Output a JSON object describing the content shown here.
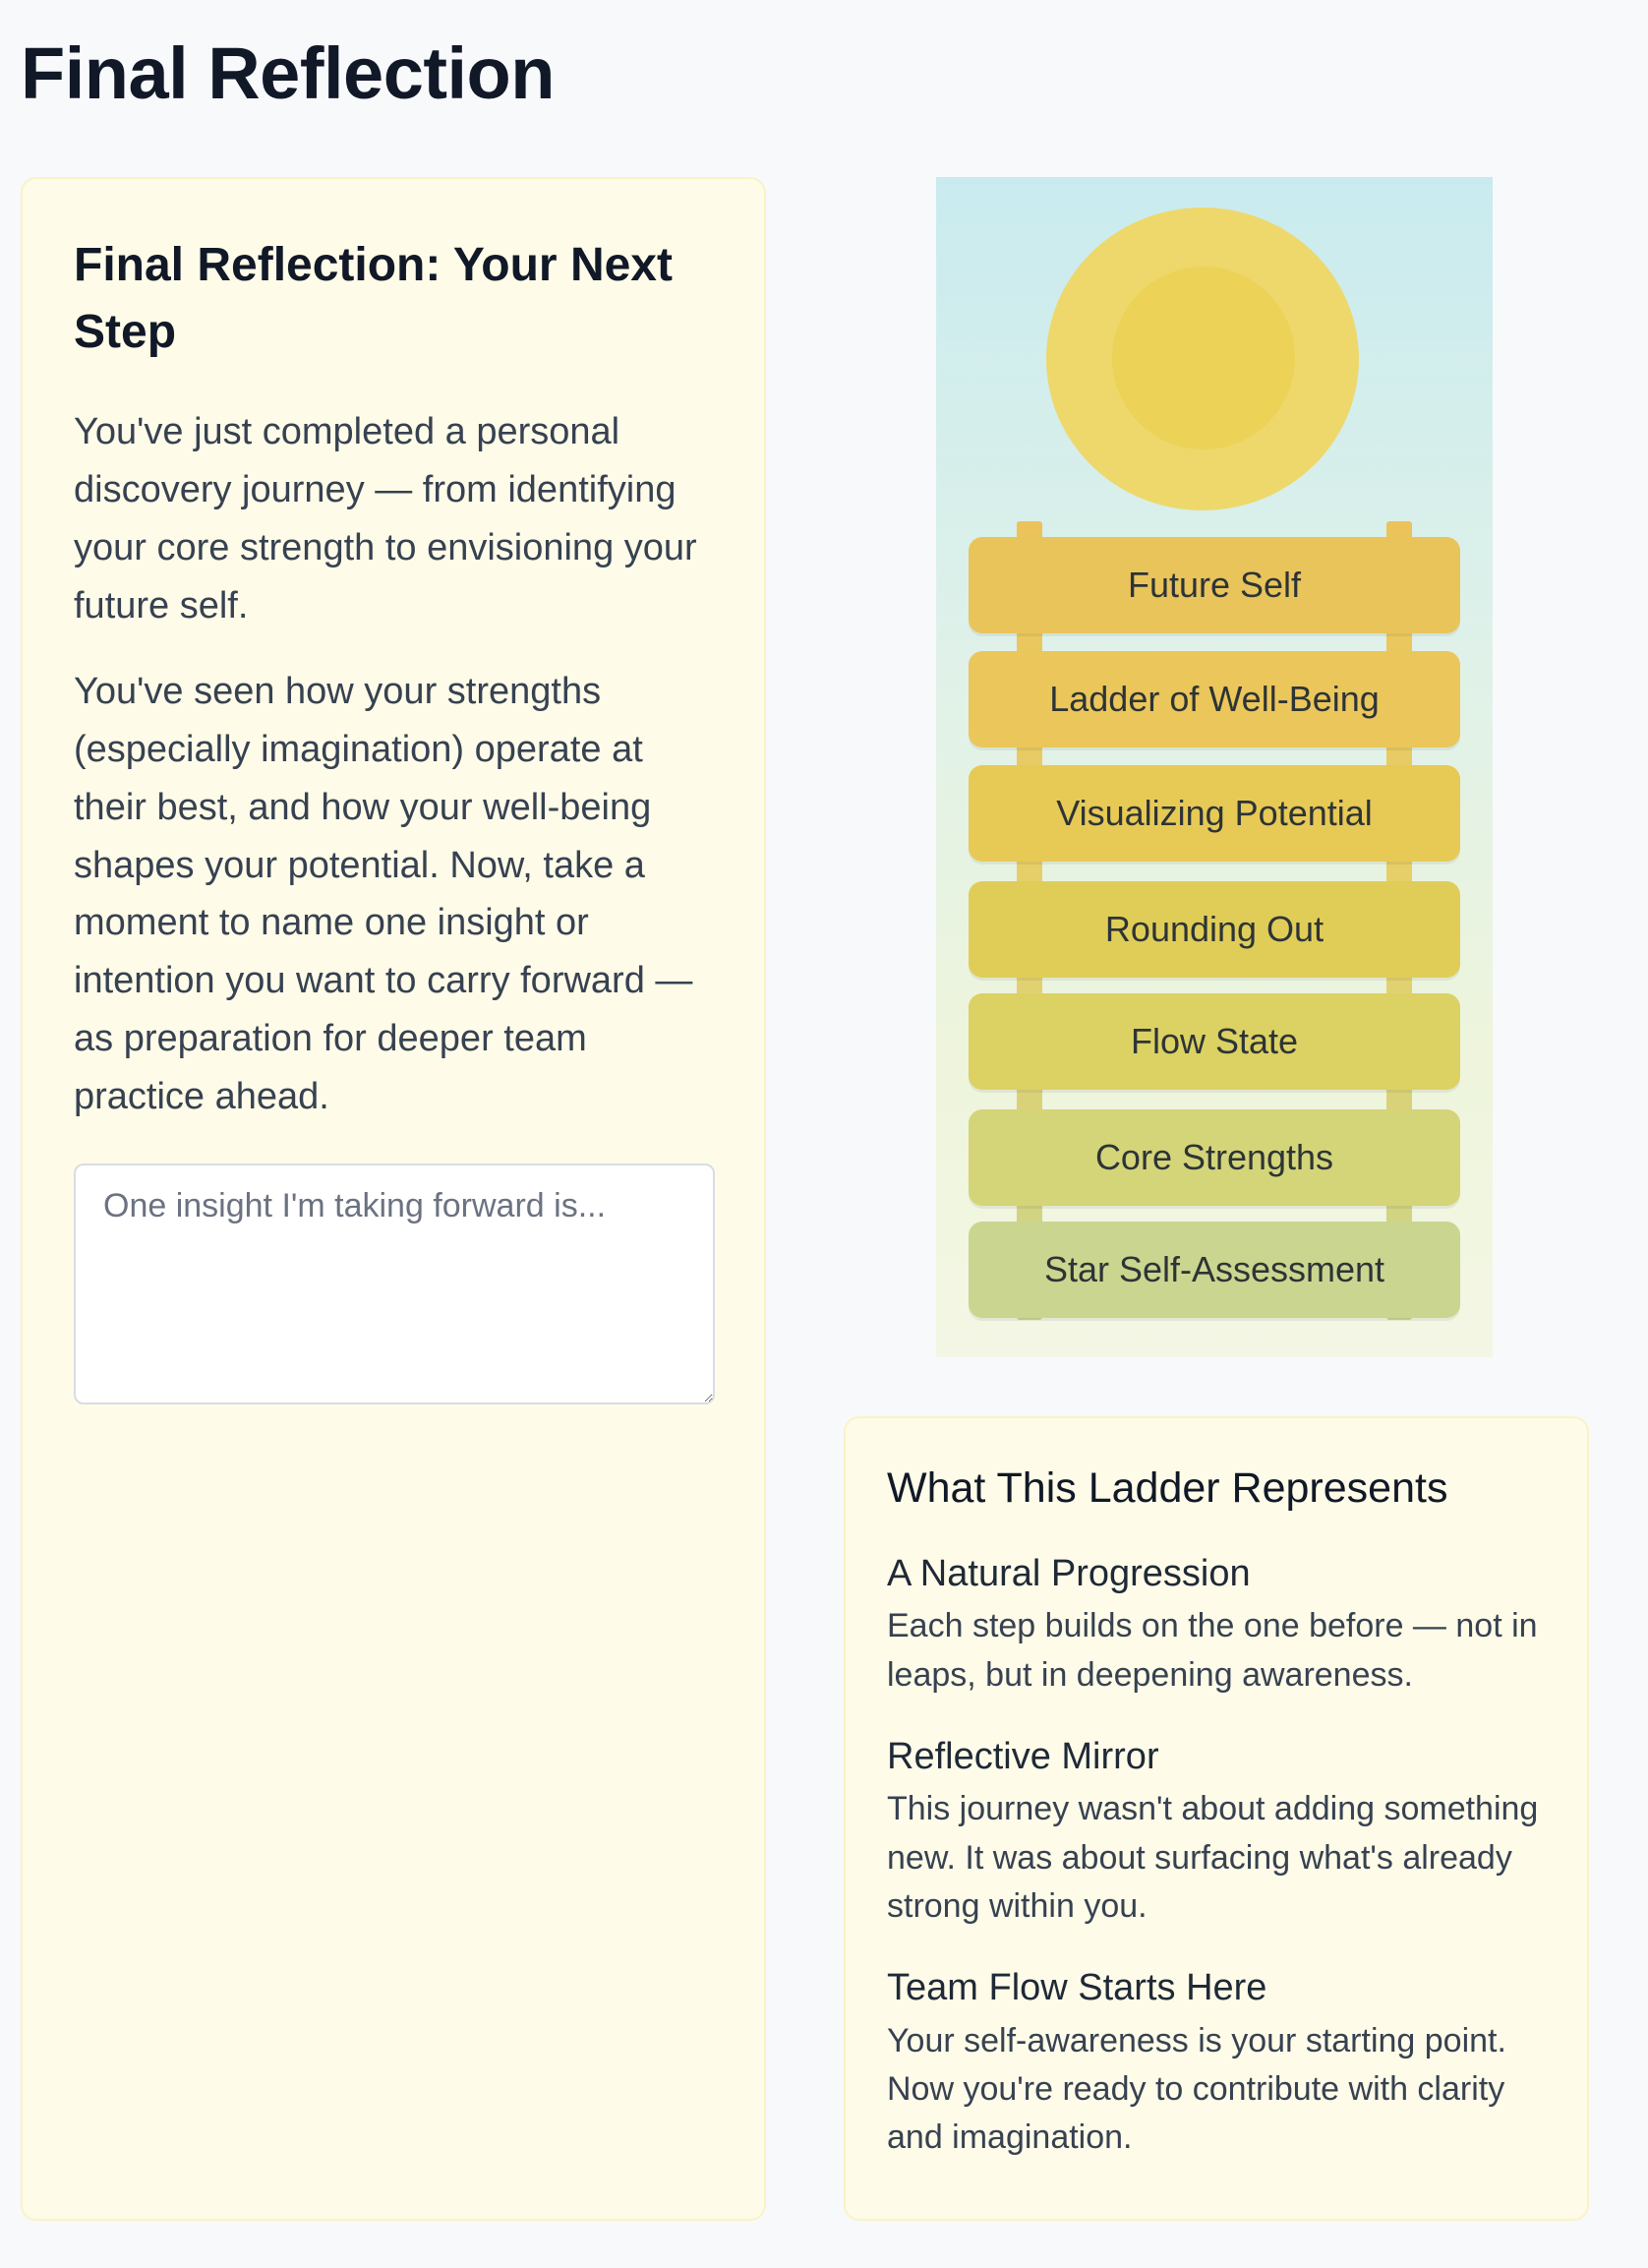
{
  "page": {
    "title": "Final Reflection"
  },
  "reflection_card": {
    "heading": "Final Reflection: Your Next Step",
    "paragraph_1": "You've just completed a personal discovery journey — from identifying your core strength to envisioning your future self.",
    "paragraph_2": "You've seen how your strengths (especially imagination) operate at their best, and how your well-being shapes your potential. Now, take a moment to name one insight or intention you want to carry forward — as preparation for deeper team practice ahead.",
    "input": {
      "value": "",
      "placeholder": "One insight I'm taking forward is..."
    }
  },
  "ladder": {
    "rungs": [
      {
        "label": "Future Self",
        "color": "#e9c45b"
      },
      {
        "label": "Ladder of Well-Being",
        "color": "#ebc65a"
      },
      {
        "label": "Visualizing Potential",
        "color": "#e7c955"
      },
      {
        "label": "Rounding Out",
        "color": "#e0cd58"
      },
      {
        "label": "Flow State",
        "color": "#dcd163"
      },
      {
        "label": "Core Strengths",
        "color": "#d4d479"
      },
      {
        "label": "Star Self-Assessment",
        "color": "#cad58f"
      }
    ]
  },
  "info_card": {
    "heading": "What This Ladder Represents",
    "items": [
      {
        "title": "A Natural Progression",
        "text": "Each step builds on the one before — not in leaps, but in deepening awareness."
      },
      {
        "title": "Reflective Mirror",
        "text": "This journey wasn't about adding something new. It was about surfacing what's already strong within you."
      },
      {
        "title": "Team Flow Starts Here",
        "text": "Your self-awareness is your starting point. Now you're ready to contribute with clarity and imagination."
      }
    ]
  }
}
